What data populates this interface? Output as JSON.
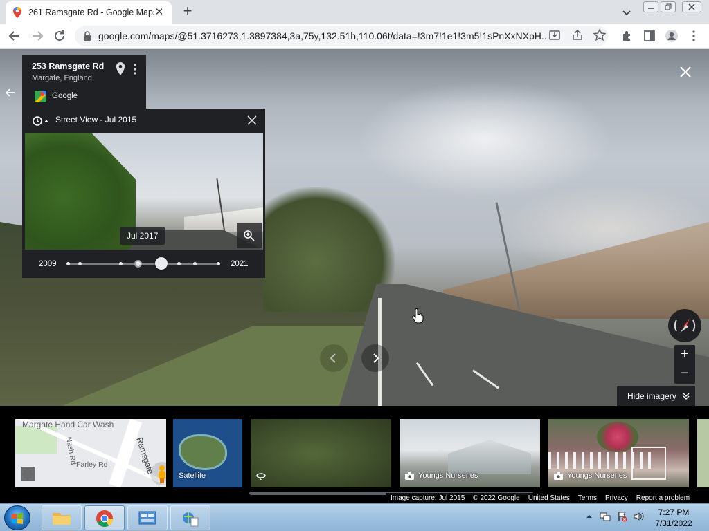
{
  "browser": {
    "tab_title": "261 Ramsgate Rd - Google Maps",
    "url": "google.com/maps/@51.3716273,1.3897384,3a,75y,132.51h,110.06t/data=!3m7!1e1!3m5!1sPnXxNXpH..."
  },
  "address_card": {
    "title": "253 Ramsgate Rd",
    "subtitle": "Margate, England",
    "provider": "Google"
  },
  "time_machine": {
    "title": "Street View - Jul 2015",
    "selected_date": "Jul 2017",
    "start_year": "2009",
    "end_year": "2021",
    "slider_position_fraction": 0.62
  },
  "controls": {
    "hide_imagery_label": "Hide imagery",
    "zoom_in": "+",
    "zoom_out": "−"
  },
  "filmstrip": {
    "map_title": "Margate Hand Car Wash",
    "map_labels": [
      "Nash Rd",
      "Farley Rd",
      "Ramsgate"
    ],
    "satellite_label": "Satellite",
    "photo_1_label": "Youngs Nurseries",
    "photo_2_label": "Youngs Nurseries"
  },
  "footer": {
    "image_capture": "Image capture: Jul 2015",
    "copyright": "© 2022 Google",
    "country": "United States",
    "terms": "Terms",
    "privacy": "Privacy",
    "report": "Report a problem"
  },
  "taskbar": {
    "time": "7:27 PM",
    "date": "7/31/2022"
  },
  "colors": {
    "panel_bg": "#202124",
    "taskbar": "#9ec1df",
    "accent_red": "#ea4335"
  }
}
